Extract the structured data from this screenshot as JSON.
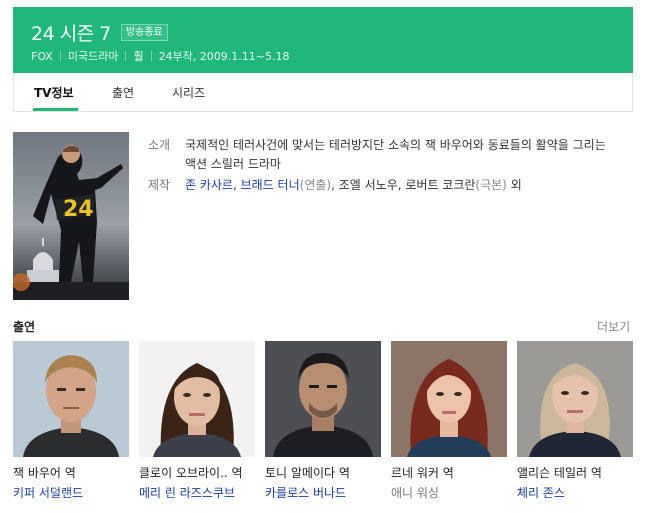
{
  "header": {
    "title": "24 시즌 7",
    "badge": "방송종료",
    "meta": [
      "FOX",
      "미국드라마",
      "훨",
      "24부작, 2009.1.11~5.18"
    ]
  },
  "tabs": [
    {
      "label": "TV정보",
      "active": true
    },
    {
      "label": "출연",
      "active": false
    },
    {
      "label": "시리즈",
      "active": false
    }
  ],
  "poster": {
    "text": "24"
  },
  "info": {
    "intro_label": "소개",
    "intro_text": "국제적인 테러사건에 맞서는 테러방지단 소속의 잭 바우어와 동료들의 활약을 그리는 액션 스릴러 드라마",
    "staff_label": "제작",
    "staff": {
      "director1": "존 카사르",
      "director2": "브래드 터너",
      "director_role": "(연출)",
      "writers": ", 조엘 서노우, 로버트 코크란",
      "writer_role": "(극본)",
      "suffix": " 외"
    }
  },
  "cast_section": {
    "title": "출연",
    "more": "더보기",
    "members": [
      {
        "role": "잭 바우어 역",
        "actor": "키퍼 서덜랜드",
        "linked": true
      },
      {
        "role": "클로이 오브라이.. 역",
        "actor": "메리 린 라즈스쿠브",
        "linked": true
      },
      {
        "role": "토니 알메이다 역",
        "actor": "카를로스 버나드",
        "linked": true
      },
      {
        "role": "르네 워커 역",
        "actor": "애니 워싱",
        "linked": false
      },
      {
        "role": "앨리슨 테일러 역",
        "actor": "체리 존스",
        "linked": true
      }
    ]
  },
  "colors": {
    "accent": "#1fb77a",
    "link": "#1a3e9e"
  }
}
